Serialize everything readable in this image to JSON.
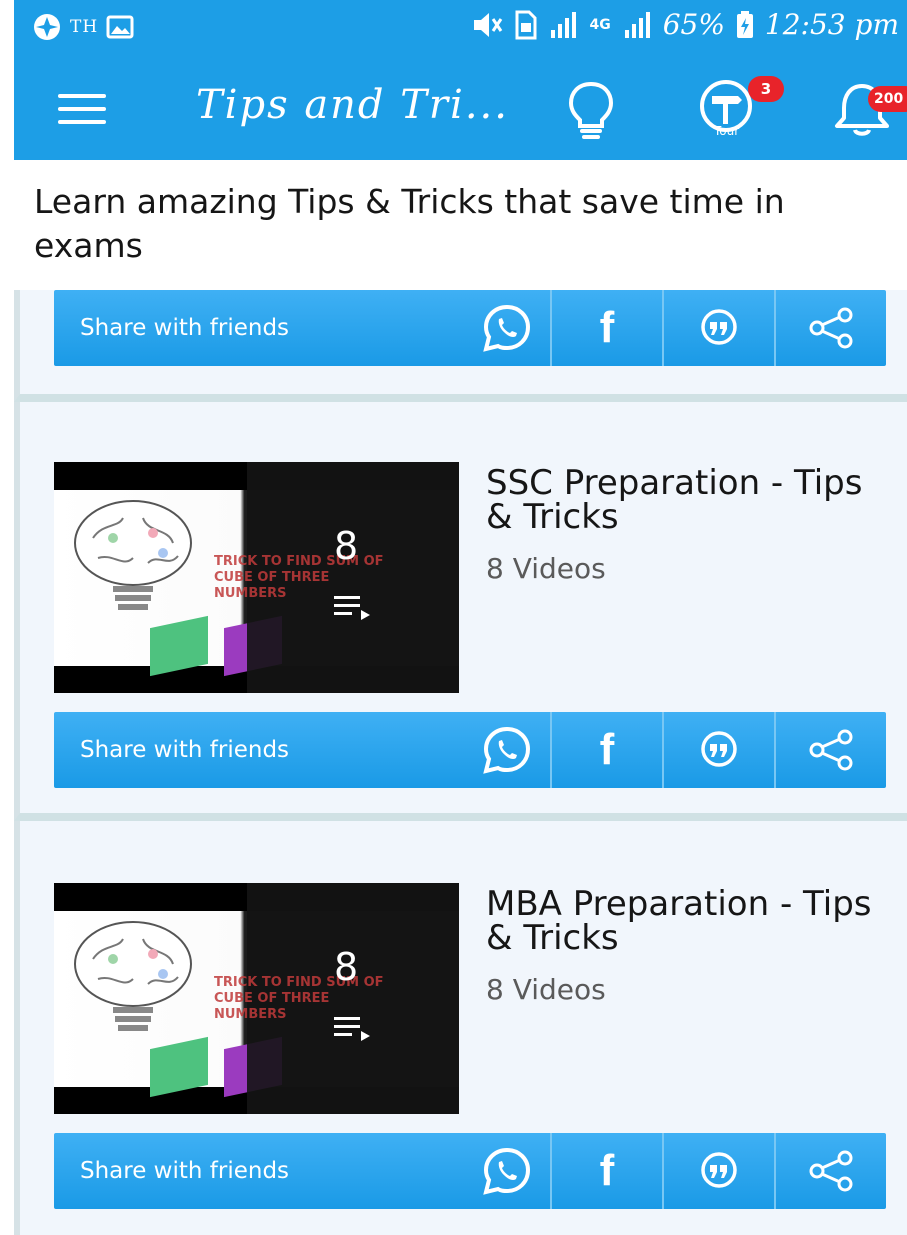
{
  "status_bar": {
    "left_text": "TH",
    "battery": "65%",
    "time": "12:53 pm",
    "network": "4G"
  },
  "app_bar": {
    "title": "Tips and Tri...",
    "tour_label": "Tour",
    "tour_badge": "3",
    "notification_badge": "200"
  },
  "heading": "Learn amazing Tips & Tricks that save time in exams",
  "share": {
    "label": "Share with friends"
  },
  "playlists": [
    {
      "title": "SSC Preparation - Tips & Tricks",
      "video_count_label": "8 Videos",
      "thumb_count": "8",
      "thumb_text": "TRICK TO FIND SUM OF CUBE OF THREE NUMBERS"
    },
    {
      "title": "MBA Preparation - Tips & Tricks",
      "video_count_label": "8 Videos",
      "thumb_count": "8",
      "thumb_text": "TRICK TO FIND SUM OF CUBE OF THREE NUMBERS"
    }
  ],
  "colors": {
    "primary": "#1d9ee6",
    "card_bg": "#f1f6fc",
    "badge": "#e8232a"
  }
}
